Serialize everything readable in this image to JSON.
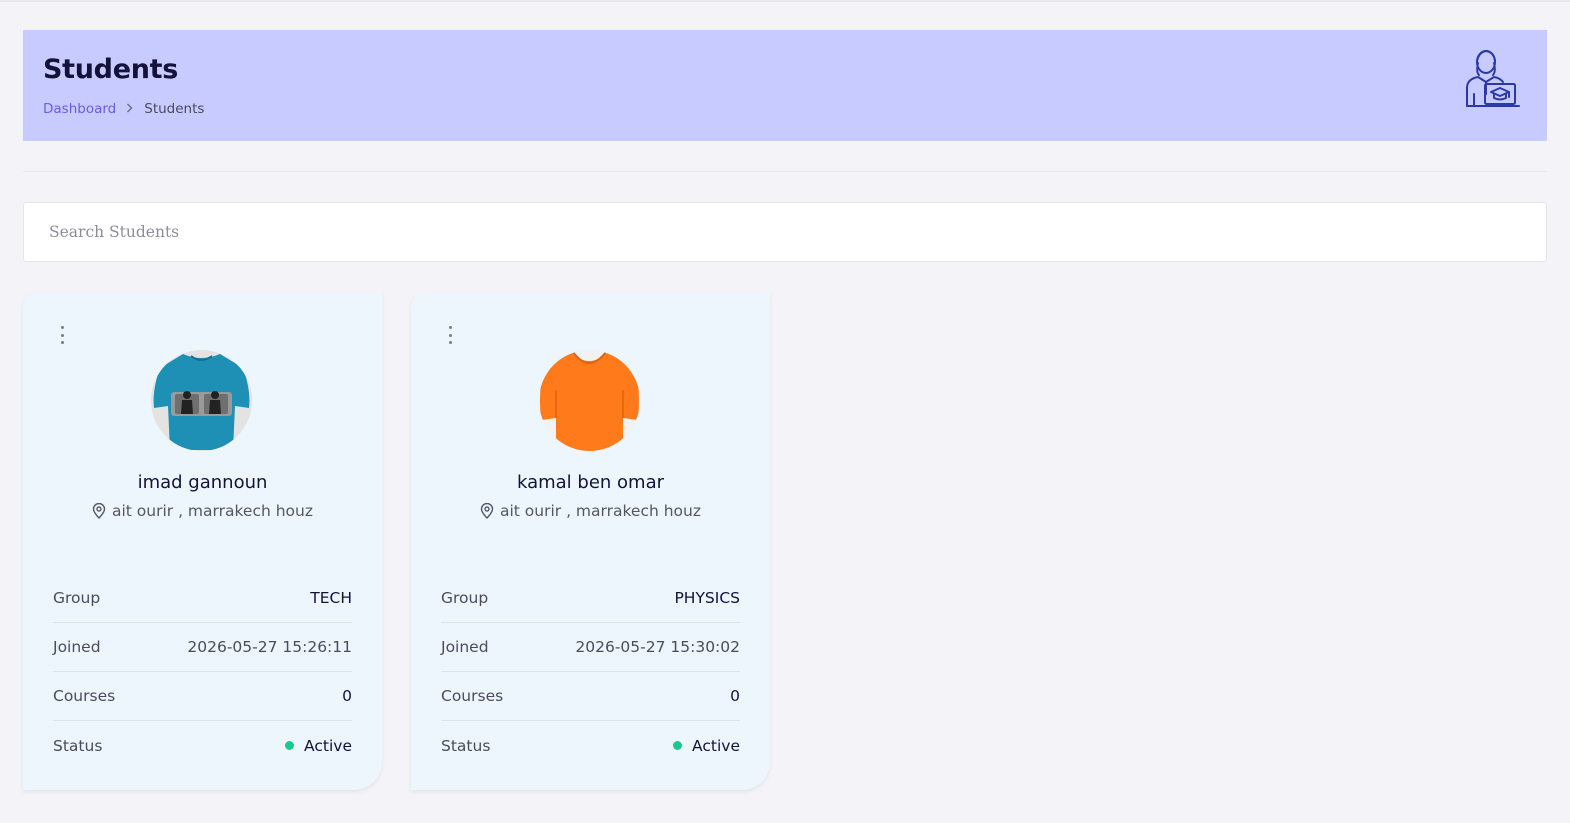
{
  "page": {
    "title": "Students",
    "breadcrumb": {
      "home": "Dashboard",
      "current": "Students"
    }
  },
  "search": {
    "placeholder": "Search Students",
    "value": ""
  },
  "labels": {
    "group": "Group",
    "joined": "Joined",
    "courses": "Courses",
    "status": "Status"
  },
  "students": [
    {
      "name": "imad gannoun",
      "location": "ait ourir , marrakech houz",
      "group": "TECH",
      "joined": "2026-05-27 15:26:11",
      "courses": "0",
      "status": "Active",
      "avatar_color": "#1e8fb5"
    },
    {
      "name": "kamal ben omar",
      "location": "ait ourir , marrakech houz",
      "group": "PHYSICS",
      "joined": "2026-05-27 15:30:02",
      "courses": "0",
      "status": "Active",
      "avatar_color": "#ff7a1a"
    }
  ],
  "colors": {
    "header_bg": "#c7cbff",
    "accent": "#6c5ce7",
    "card_bg": "#eef6fd",
    "status_active": "#1bc98e"
  },
  "icons": {
    "header": "student-graduation-icon",
    "menu": "more-vertical-icon",
    "location": "map-pin-icon",
    "breadcrumb_sep": "chevron-right-icon"
  }
}
